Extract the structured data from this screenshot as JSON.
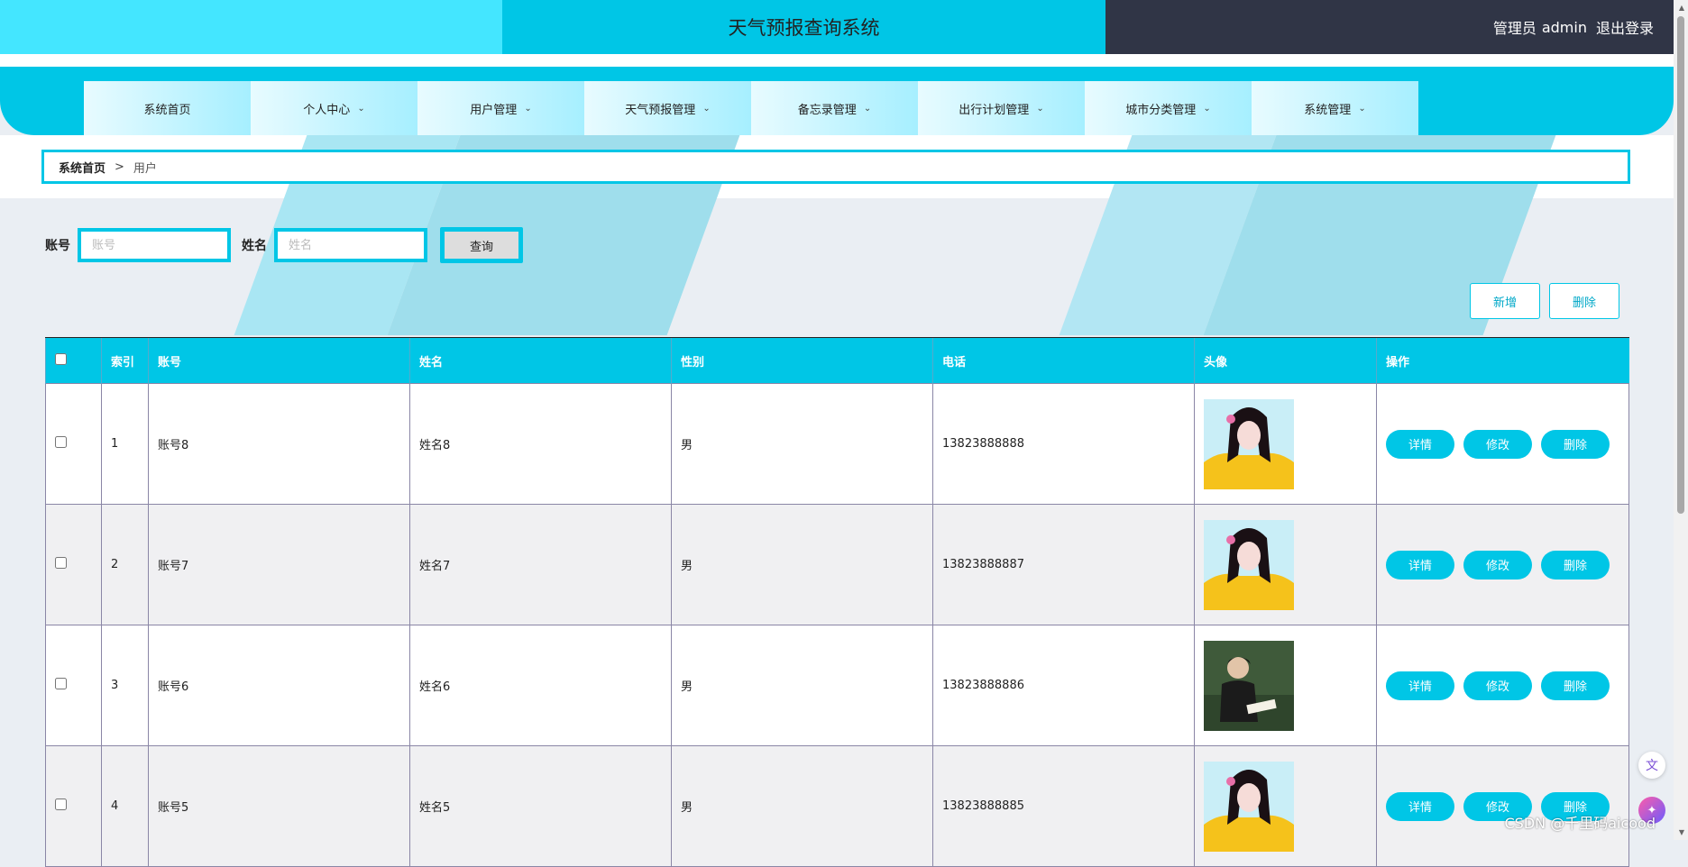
{
  "header": {
    "title": "天气预报查询系统",
    "role": "管理员",
    "username": "admin",
    "logout": "退出登录"
  },
  "nav": {
    "items": [
      {
        "label": "系统首页",
        "has_menu": false
      },
      {
        "label": "个人中心",
        "has_menu": true
      },
      {
        "label": "用户管理",
        "has_menu": true
      },
      {
        "label": "天气预报管理",
        "has_menu": true
      },
      {
        "label": "备忘录管理",
        "has_menu": true
      },
      {
        "label": "出行计划管理",
        "has_menu": true
      },
      {
        "label": "城市分类管理",
        "has_menu": true
      },
      {
        "label": "系统管理",
        "has_menu": true
      }
    ]
  },
  "breadcrumb": {
    "home": "系统首页",
    "separator": ">",
    "current": "用户"
  },
  "search": {
    "account_label": "账号",
    "account_placeholder": "账号",
    "name_label": "姓名",
    "name_placeholder": "姓名",
    "query_button": "查询"
  },
  "actions": {
    "add": "新增",
    "delete": "删除"
  },
  "table": {
    "columns": [
      "索引",
      "账号",
      "姓名",
      "性别",
      "电话",
      "头像",
      "操作"
    ],
    "row_actions": [
      "详情",
      "修改",
      "删除"
    ],
    "rows": [
      {
        "index": "1",
        "account": "账号8",
        "name": "姓名8",
        "gender": "男",
        "phone": "13823888888",
        "avatar": "girl-yellow"
      },
      {
        "index": "2",
        "account": "账号7",
        "name": "姓名7",
        "gender": "男",
        "phone": "13823888887",
        "avatar": "girl-yellow"
      },
      {
        "index": "3",
        "account": "账号6",
        "name": "姓名6",
        "gender": "男",
        "phone": "13823888886",
        "avatar": "boy-reading"
      },
      {
        "index": "4",
        "account": "账号5",
        "name": "姓名5",
        "gender": "男",
        "phone": "13823888885",
        "avatar": "girl-yellow"
      }
    ]
  },
  "watermark": "CSDN @千里码aicood",
  "colors": {
    "accent": "#00c6e6",
    "header_light": "#44e6ff",
    "header_dark": "#303546"
  }
}
